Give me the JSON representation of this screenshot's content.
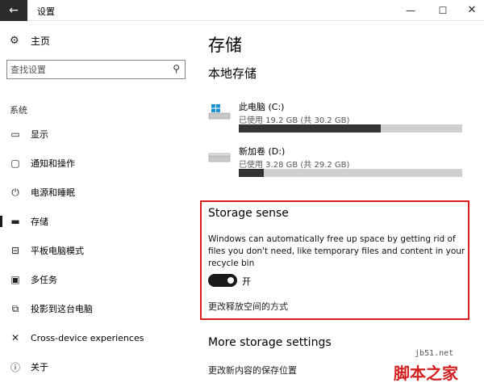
{
  "window": {
    "title": "设置",
    "back_glyph": "←",
    "minimize_glyph": "—",
    "maximize_glyph": "☐",
    "close_glyph": "✕"
  },
  "sidebar": {
    "home_label": "主页",
    "search": {
      "placeholder": "查找设置",
      "value": "查找设置"
    },
    "section_label": "系统",
    "items": [
      {
        "label": "显示",
        "icon": "monitor-icon",
        "glyph": "▭"
      },
      {
        "label": "通知和操作",
        "icon": "notification-icon",
        "glyph": "▢"
      },
      {
        "label": "电源和睡眠",
        "icon": "power-icon",
        "glyph": "⏻"
      },
      {
        "label": "存储",
        "icon": "storage-icon",
        "glyph": "▬",
        "selected": true
      },
      {
        "label": "平板电脑模式",
        "icon": "tablet-icon",
        "glyph": "⊟"
      },
      {
        "label": "多任务",
        "icon": "multitask-icon",
        "glyph": "▣"
      },
      {
        "label": "投影到这台电脑",
        "icon": "projector-icon",
        "glyph": "⧉"
      },
      {
        "label": "Cross-device experiences",
        "icon": "cross-device-icon",
        "glyph": "✕"
      },
      {
        "label": "关于",
        "icon": "info-icon",
        "glyph": "ⓘ"
      }
    ]
  },
  "main": {
    "title": "存储",
    "local_storage": "本地存储",
    "drives": [
      {
        "name": "此电脑 (C:)",
        "usage": "已使用 19.2 GB (共 30.2 GB)",
        "used_fraction": 0.636,
        "icon": "windows-drive-icon"
      },
      {
        "name": "新加卷 (D:)",
        "usage": "已使用 3.28 GB (共 29.2 GB)",
        "used_fraction": 0.112,
        "icon": "drive-icon"
      }
    ],
    "storage_sense": {
      "title": "Storage sense",
      "description": "Windows can automatically free up space by getting rid of files you don't need, like temporary files and content in your recycle bin",
      "toggle_on": true,
      "toggle_label": "开",
      "link": "更改释放空间的方式"
    },
    "more_storage": {
      "title": "More storage settings",
      "link": "更改新内容的保存位置"
    }
  },
  "watermark": {
    "url": "jb51.net",
    "brand": "脚本之家"
  },
  "colors": {
    "accent_dark": "#1a1a1a",
    "highlight_border": "#d81e1e",
    "bar_bg": "#cfcfcf",
    "bar_fill": "#333333",
    "watermark": "#d32020"
  }
}
